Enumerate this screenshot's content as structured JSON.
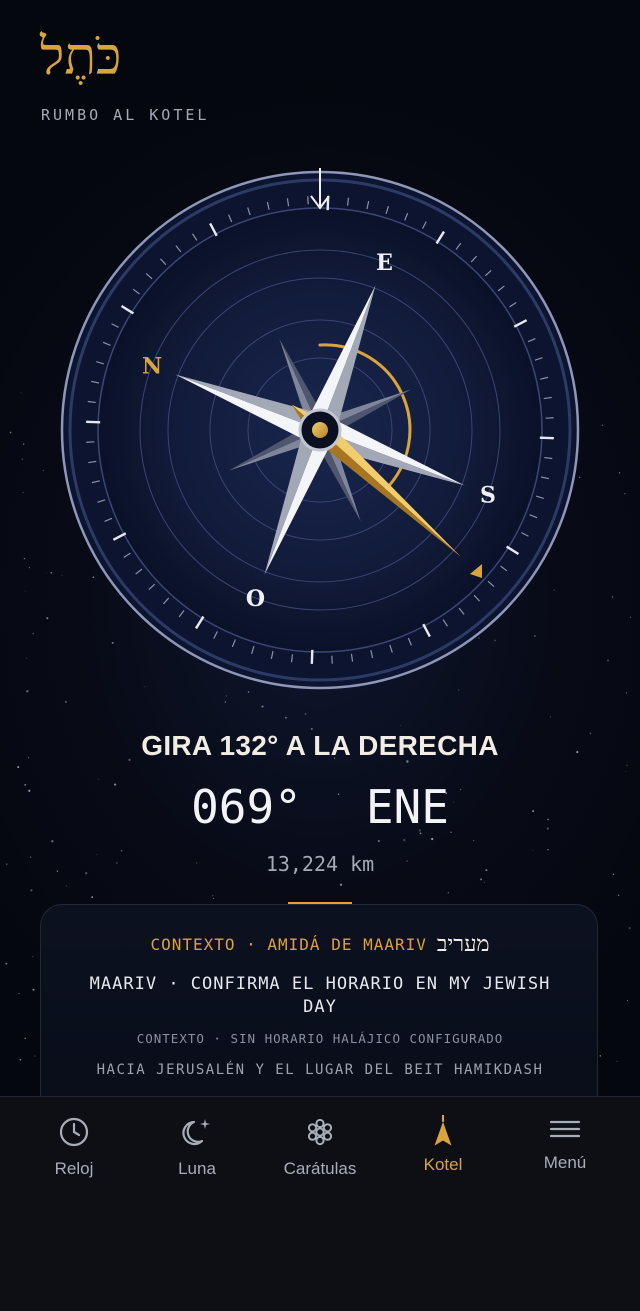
{
  "header": {
    "logo_text": "כֹּתֶל",
    "subtitle": "RUMBO AL KOTEL"
  },
  "compass": {
    "cardinals": {
      "north": "N",
      "east": "E",
      "south": "S",
      "west": "O"
    },
    "heading_deg": 69,
    "needle_target_deg": 132,
    "accent": "#d9a43a"
  },
  "direction": {
    "instruction": "GIRA 132° A LA DERECHA",
    "heading": "069°",
    "cardinal": "ENE",
    "distance": "13,224 km"
  },
  "context": {
    "header": "CONTEXTO · AMIDÁ DE MAARIV",
    "hebrew": "מעריב",
    "main": "MAARIV · CONFIRMA EL HORARIO EN MY JEWISH DAY",
    "sub": "CONTEXTO · SIN HORARIO HALÁJICO CONFIGURADO",
    "sub2": "HACIA JERUSALÉN Y EL LUGAR DEL BEIT HAMIKDASH"
  },
  "tabs": [
    {
      "label": "Reloj",
      "icon": "clock-icon"
    },
    {
      "label": "Luna",
      "icon": "moon-icon"
    },
    {
      "label": "Carátulas",
      "icon": "dials-icon"
    },
    {
      "label": "Kotel",
      "icon": "kotel-arrow-icon",
      "active": true
    },
    {
      "label": "Menú",
      "icon": "menu-icon"
    }
  ]
}
